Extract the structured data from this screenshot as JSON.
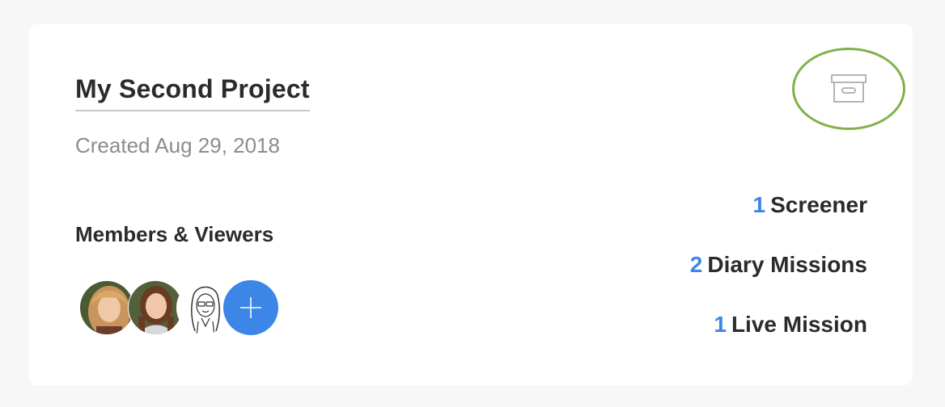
{
  "project": {
    "title": "My Second Project",
    "created": "Created Aug 29, 2018"
  },
  "archive": {
    "icon": "archive-box-icon",
    "highlight_color": "#7fb24a"
  },
  "members": {
    "label": "Members & Viewers",
    "avatars": [
      {
        "name": "avatar-1"
      },
      {
        "name": "avatar-2"
      },
      {
        "name": "avatar-3"
      }
    ],
    "add_icon": "plus-icon",
    "accent": "#3b86e6"
  },
  "stats": [
    {
      "count": "1",
      "label": "Screener"
    },
    {
      "count": "2",
      "label": "Diary Missions"
    },
    {
      "count": "1",
      "label": "Live Mission"
    }
  ]
}
